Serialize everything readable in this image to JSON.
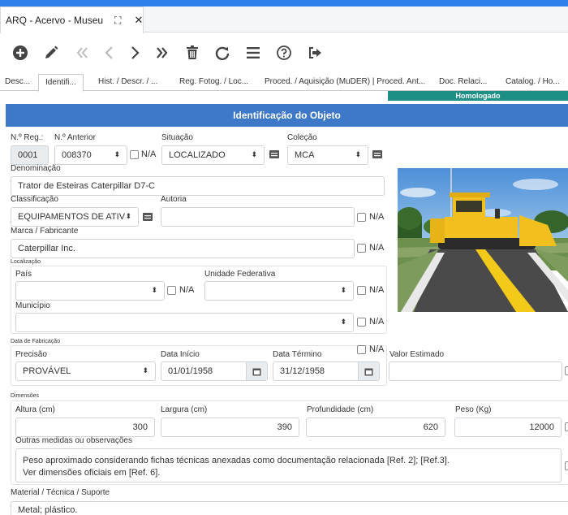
{
  "app": {
    "tab_title": "ARQ - Acervo - Museu"
  },
  "toolbar": {
    "icons": [
      "add-icon",
      "edit-icon",
      "first-icon",
      "prev-icon",
      "next-icon",
      "last-icon",
      "delete-icon",
      "refresh-icon",
      "menu-icon",
      "help-icon",
      "exit-icon"
    ]
  },
  "subtabs": [
    "Desc...",
    "Identifi...",
    "Hist. / Descr. / ...",
    "Reg. Fotog. / Loc...",
    "Proced. / Aquisição (MuDER) | Proced. Ant...",
    "Doc. Relaci...",
    "Catalog. / Ho..."
  ],
  "status_badge": "Homologado",
  "section_title": "Identificação do Objeto",
  "form": {
    "nreg_label": "N.º Reg.:",
    "nreg_value": "0001",
    "nant_label": "N.º Anterior",
    "nant_value": "008370",
    "na": "N/A",
    "situacao_label": "Situação",
    "situacao_value": "LOCALIZADO",
    "colecao_label": "Coleção",
    "colecao_value": "MCA",
    "denominacao_label": "Denominação",
    "denominacao_value": "Trator de Esteiras Caterpillar D7-C",
    "classificacao_label": "Classificação",
    "classificacao_value": "EQUIPAMENTOS DE ATIV",
    "autoria_label": "Autoria",
    "autoria_value": "",
    "marca_label": "Marca / Fabricante",
    "marca_value": "Caterpillar Inc.",
    "localizacao_label": "Localização",
    "pais_label": "País",
    "pais_value": "",
    "uf_label": "Unidade Federativa",
    "uf_value": "",
    "municipio_label": "Município",
    "municipio_value": "",
    "fabricacao_label": "Data de Fabricação",
    "precisao_label": "Precisão",
    "precisao_value": "PROVÁVEL",
    "inicio_label": "Data Início",
    "inicio_value": "01/01/1958",
    "termino_label": "Data Término",
    "termino_value": "31/12/1958",
    "valor_label": "Valor Estimado",
    "valor_value": "",
    "dimensoes_label": "Dimensões",
    "altura_label": "Altura (cm)",
    "altura_value": "300",
    "largura_label": "Largura (cm)",
    "largura_value": "390",
    "profundidade_label": "Profundidade (cm)",
    "profundidade_value": "620",
    "peso_label": "Peso (Kg)",
    "peso_value": "12000",
    "outras_label": "Outras medidas ou observações",
    "outras_line1": "Peso aproximado considerando fichas técnicas anexadas como documentação relacionada [Ref. 2]; [Ref.3].",
    "outras_line2": "Ver dimensões oficiais em [Ref. 6].",
    "material_label": "Material / Técnica / Suporte",
    "material_value": "Metal; plástico."
  },
  "colors": {
    "accent": "#2f80ed",
    "section": "#3e78c8",
    "badge": "#1e8f85",
    "bulldozer": "#f2c01e"
  }
}
